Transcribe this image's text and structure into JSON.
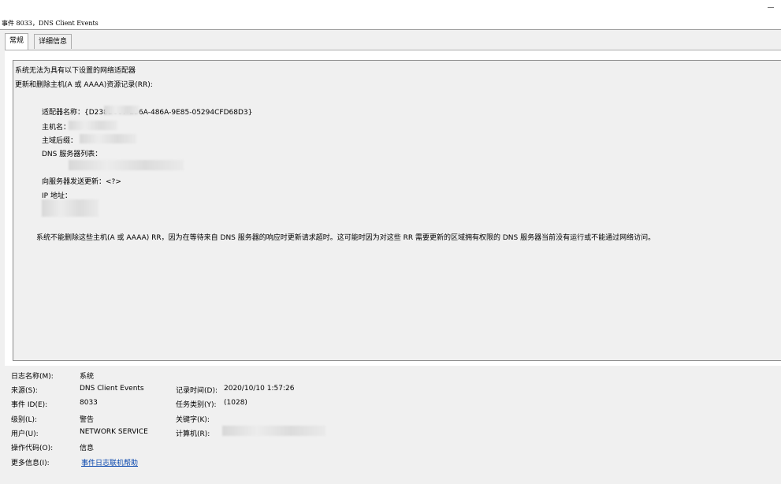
{
  "window": {
    "title": "事件 8033，DNS Client Events"
  },
  "tabs": [
    {
      "label": "常规",
      "active": true
    },
    {
      "label": "详细信息",
      "active": false
    }
  ],
  "message": {
    "line1": "系统无法为具有以下设置的网络适配器",
    "line2": "更新和删除主机(A 或 AAAA)资源记录(RR):",
    "adapter_name_label": "适配器名称：{D238D007-EB6A-486A-9E85-05294CFD68D3}",
    "host_name_label": "主机名：",
    "primary_suffix_label": "主域后缀：",
    "dns_server_list_label": "DNS 服务器列表：",
    "send_update_label": "向服务器发送更新：<?>",
    "ip_address_label": "IP 地址：",
    "summary": "系统不能删除这些主机(A 或 AAAA) RR，因为在等待来自 DNS 服务器的响应时更新请求超时。这可能时因为对这些 RR 需要更新的区域拥有权限的 DNS 服务器当前没有运行或不能通过网络访问。"
  },
  "details": {
    "log_name_label": "日志名称(M):",
    "log_name_value": "系统",
    "source_label": "来源(S):",
    "source_value": "DNS Client Events",
    "event_id_label": "事件 ID(E):",
    "event_id_value": "8033",
    "level_label": "级别(L):",
    "level_value": "警告",
    "user_label": "用户(U):",
    "user_value": "NETWORK SERVICE",
    "opcode_label": "操作代码(O):",
    "opcode_value": "信息",
    "more_info_label": "更多信息(I):",
    "more_info_link": "事件日志联机帮助",
    "logged_label": "记录时间(D):",
    "logged_value": "2020/10/10 1:57:26",
    "task_category_label": "任务类别(Y):",
    "task_category_value": "(1028)",
    "keywords_label": "关键字(K):",
    "computer_label": "计算机(R):"
  }
}
